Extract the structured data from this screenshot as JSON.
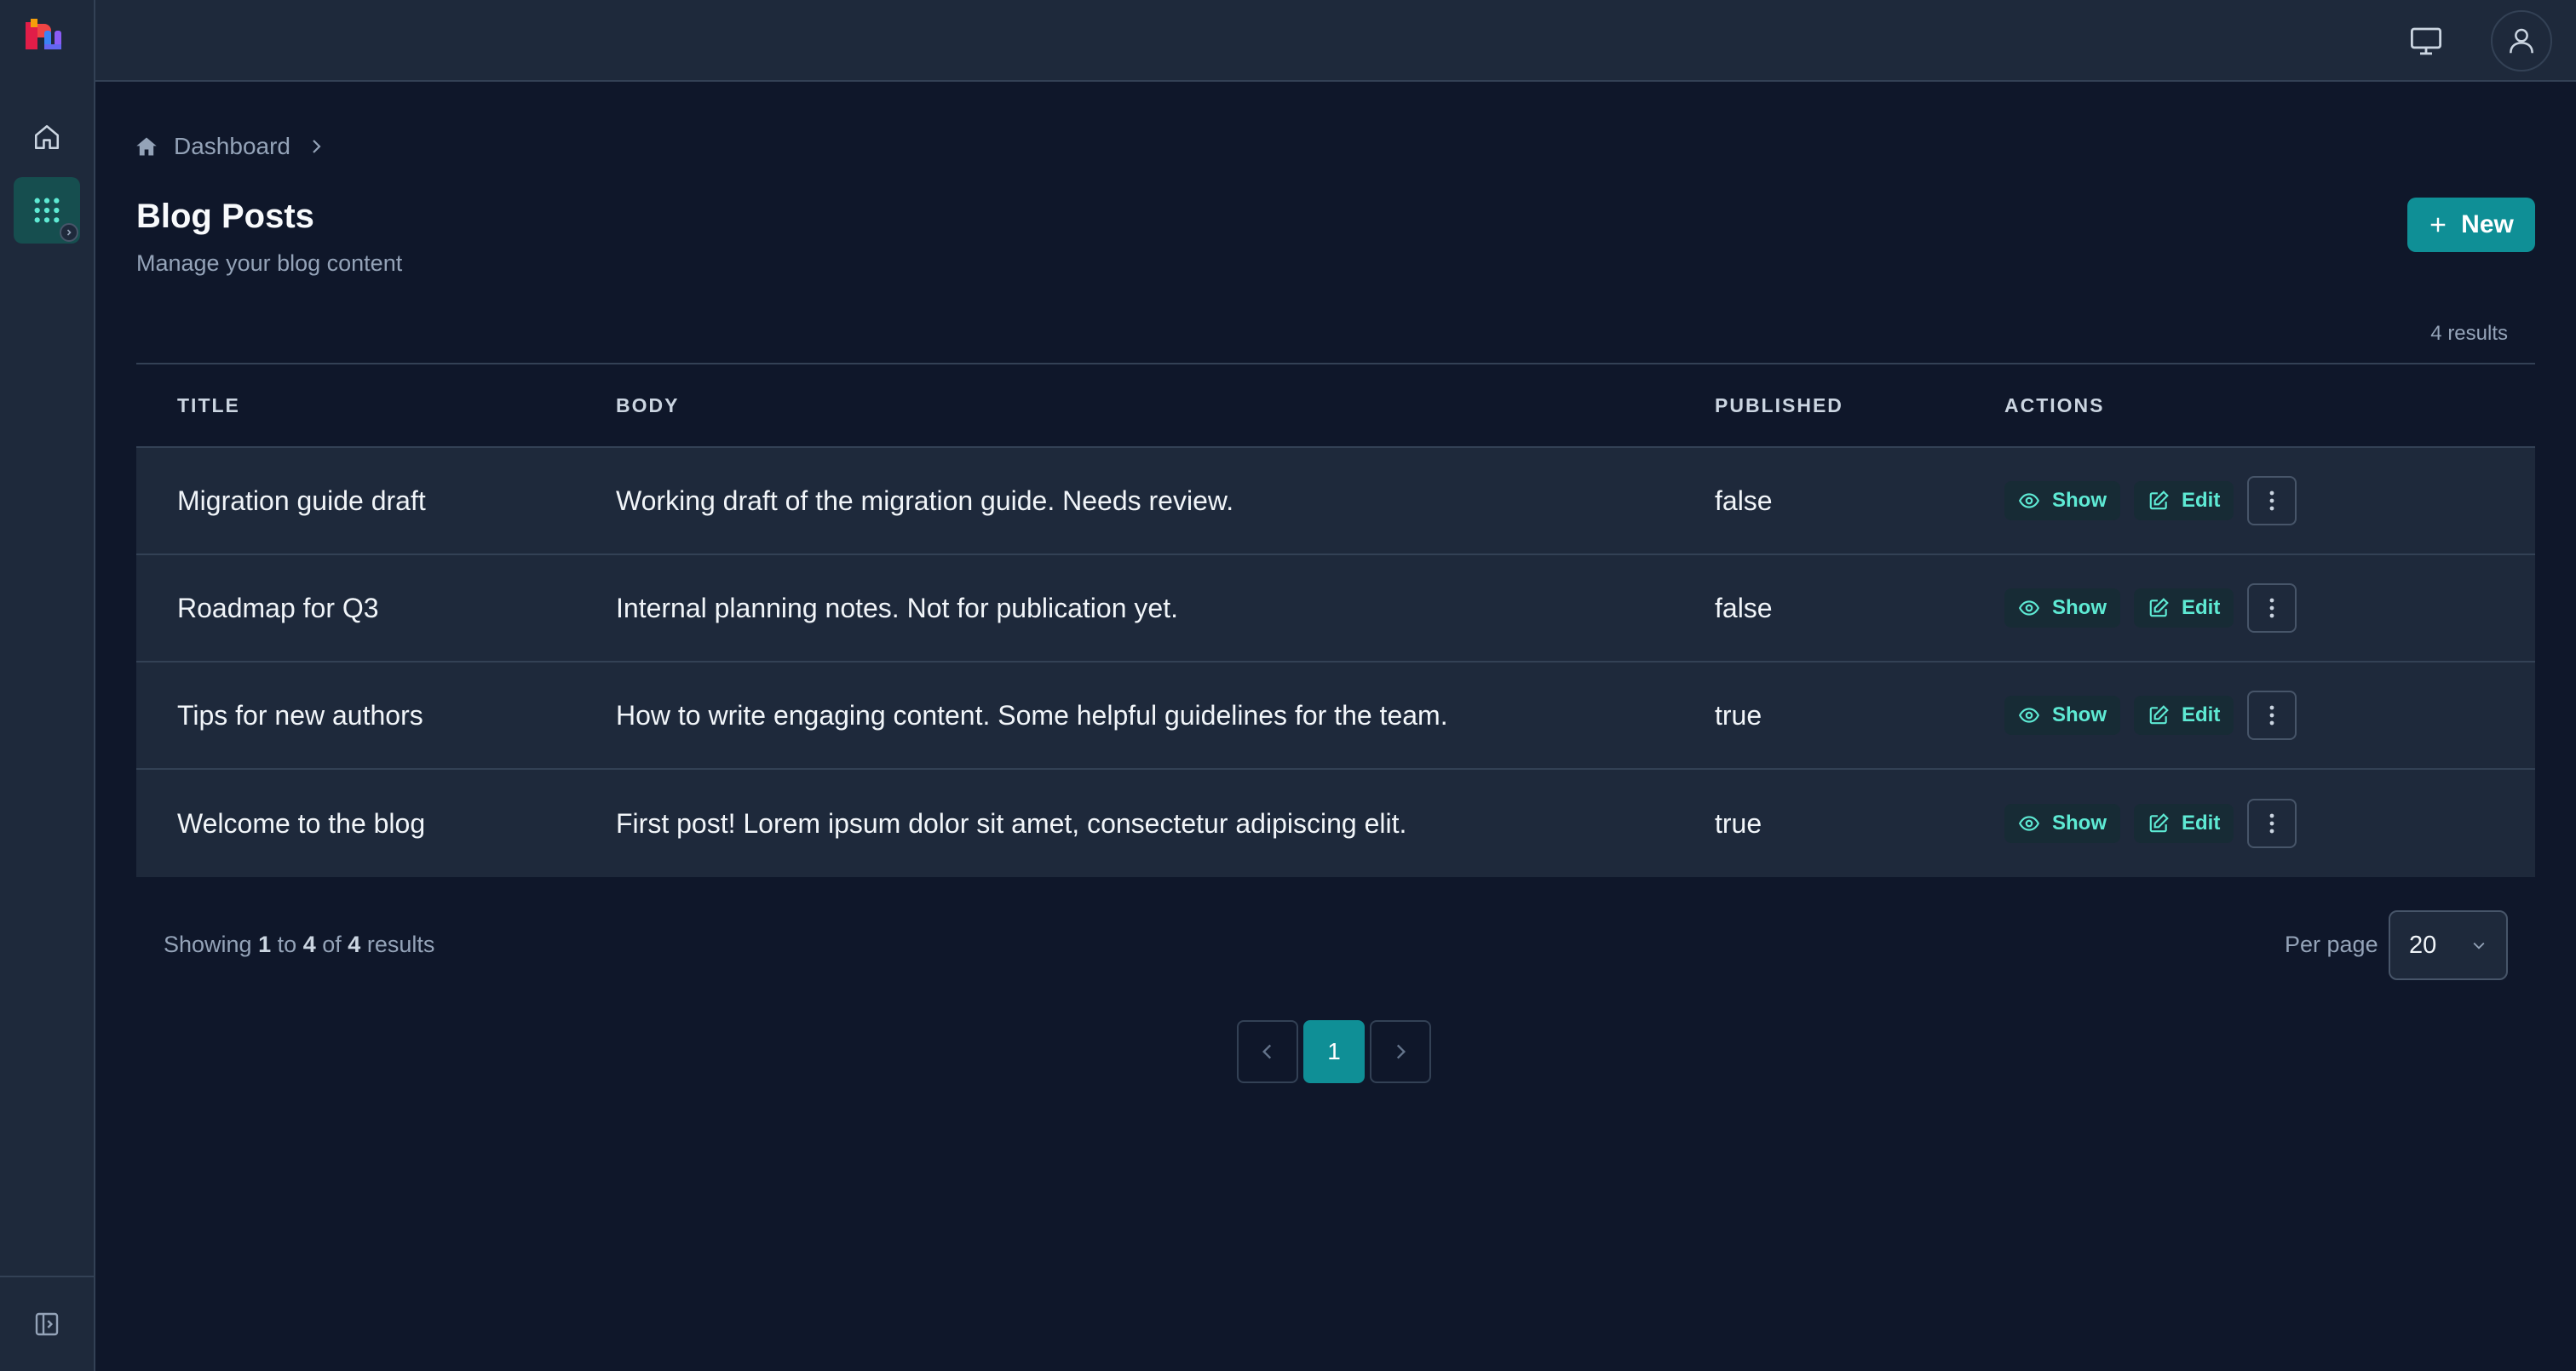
{
  "app": {
    "logo_icon": "app-logo-icon"
  },
  "sidebar": {
    "items": [
      {
        "name": "home",
        "icon": "home-icon"
      },
      {
        "name": "resources",
        "icon": "grid-icon",
        "active": true
      }
    ],
    "collapse_icon": "sidebar-collapse-icon"
  },
  "topbar": {
    "theme_icon": "monitor-icon",
    "user_icon": "user-icon"
  },
  "breadcrumb": {
    "items": [
      "Dashboard"
    ]
  },
  "page": {
    "title": "Blog Posts",
    "subtitle": "Manage your blog content",
    "new_button_label": "New",
    "results_count": "4 results"
  },
  "table": {
    "columns": [
      "TITLE",
      "BODY",
      "PUBLISHED",
      "ACTIONS"
    ],
    "rows": [
      {
        "title": "Migration guide draft",
        "body": "Working draft of the migration guide. Needs review.",
        "published": "false"
      },
      {
        "title": "Roadmap for Q3",
        "body": "Internal planning notes. Not for publication yet.",
        "published": "false"
      },
      {
        "title": "Tips for new authors",
        "body": "How to write engaging content. Some helpful guidelines for the team.",
        "published": "true"
      },
      {
        "title": "Welcome to the blog",
        "body": "First post! Lorem ipsum dolor sit amet, consectetur adipiscing elit.",
        "published": "true"
      }
    ],
    "action_labels": {
      "show": "Show",
      "edit": "Edit"
    }
  },
  "footer": {
    "showing_prefix": "Showing",
    "from": "1",
    "to_word": "to",
    "to": "4",
    "of_word": "of",
    "total": "4",
    "suffix": "results",
    "per_page_label": "Per page",
    "per_page_value": "20"
  },
  "pagination": {
    "current_page": "1"
  },
  "colors": {
    "accent": "#0f8f96",
    "background": "#0f172a",
    "surface": "#1e293b",
    "action_text": "#5eead4"
  }
}
